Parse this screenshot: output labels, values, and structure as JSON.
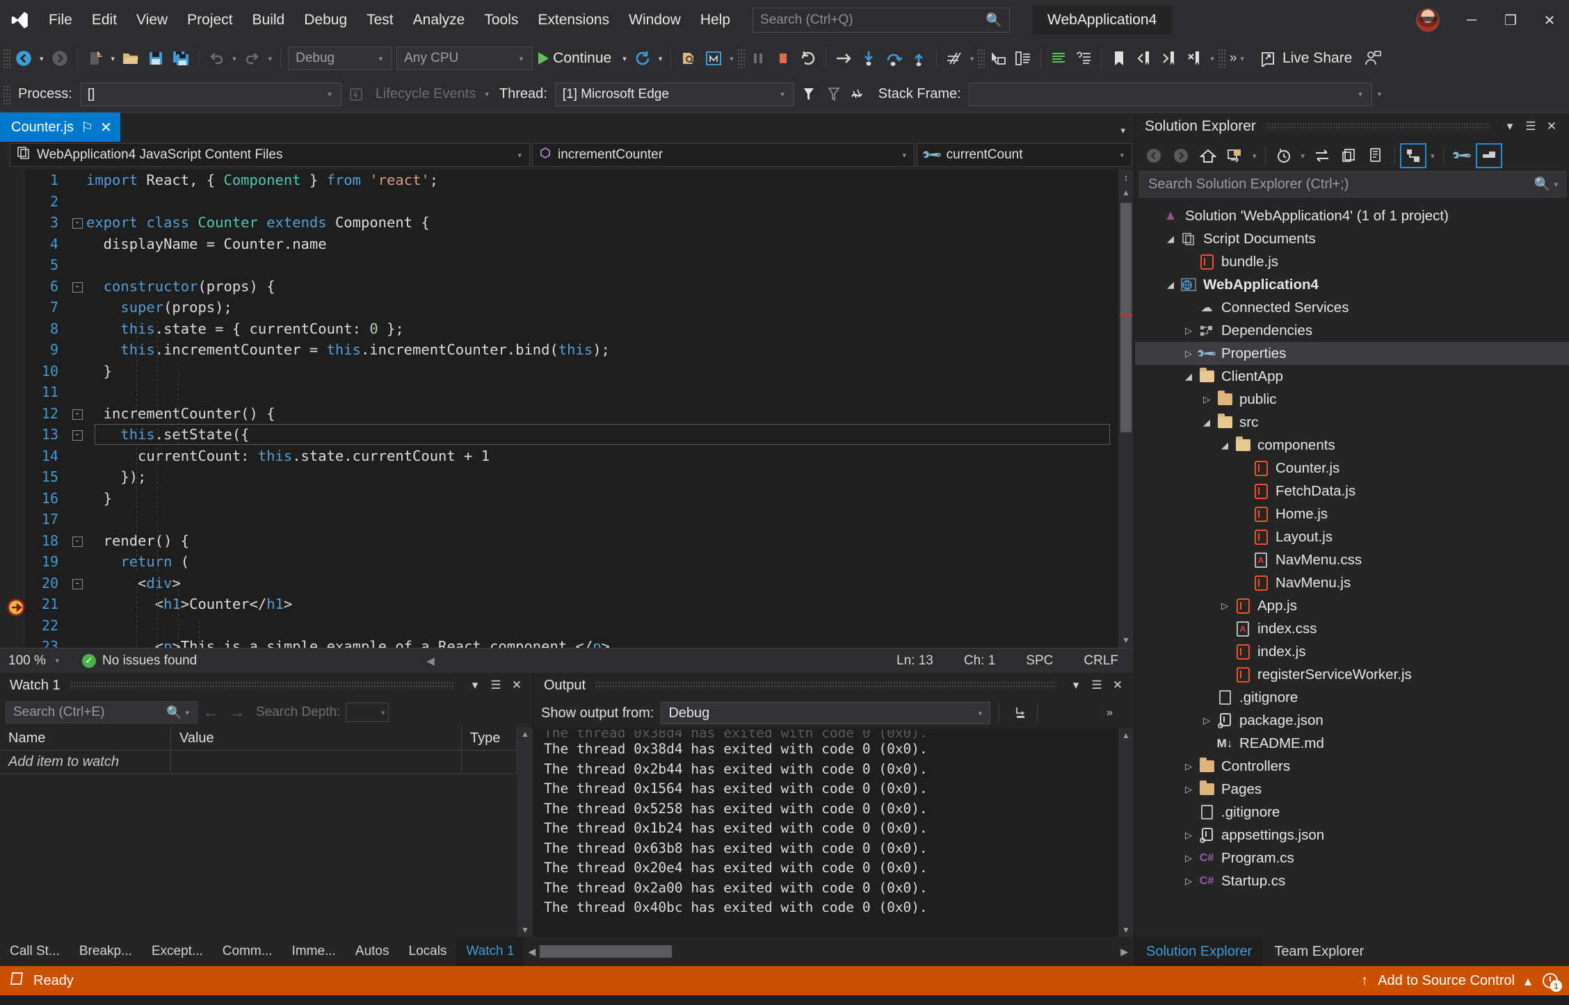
{
  "titlebar": {
    "logo": "visual-studio-logo",
    "menus": [
      "File",
      "Edit",
      "View",
      "Project",
      "Build",
      "Debug",
      "Test",
      "Analyze",
      "Tools",
      "Extensions",
      "Window",
      "Help"
    ],
    "search_placeholder": "Search (Ctrl+Q)",
    "window_title": "WebApplication4",
    "minimize": "─",
    "restore": "❐",
    "close": "✕"
  },
  "toolbar": {
    "back": "navigate-back",
    "forward": "navigate-forward",
    "new_item": "new-item",
    "open_file": "open-file",
    "save": "save",
    "save_all": "save-all",
    "undo": "undo",
    "redo": "redo",
    "config": "Debug",
    "platform": "Any CPU",
    "continue": "Continue",
    "restart": "restart",
    "attach": "attach-to-process",
    "browser": "select-browser",
    "pause": "break-all",
    "stop": "stop-debugging",
    "restart2": "restart-debugging",
    "step_over": "step-over",
    "step_into": "step-into",
    "step_out": "step-out",
    "step_up": "step-up",
    "hash": "show-next-statement",
    "live_share": "Live Share"
  },
  "debugbar": {
    "process_label": "Process:",
    "process_value": "[]",
    "lifecycle_label": "Lifecycle Events",
    "thread_label": "Thread:",
    "thread_value": "[1] Microsoft Edge",
    "stack_frame_label": "Stack Frame:",
    "stack_frame_value": ""
  },
  "editor": {
    "tab_name": "Counter.js",
    "pin": "⚐",
    "close": "✕",
    "nav_project": "WebApplication4 JavaScript Content Files",
    "nav_member": "incrementCounter",
    "nav_field": "currentCount",
    "current_line": 13,
    "code_lines": [
      {
        "n": 1,
        "fold": "",
        "tokens": [
          {
            "t": "import ",
            "c": "k-blue"
          },
          {
            "t": "React",
            "c": "k-white"
          },
          {
            "t": ", { ",
            "c": "k-white"
          },
          {
            "t": "Component",
            "c": "k-cyan"
          },
          {
            "t": " } ",
            "c": "k-white"
          },
          {
            "t": "from ",
            "c": "k-blue"
          },
          {
            "t": "'react'",
            "c": "k-str"
          },
          {
            "t": ";",
            "c": "k-white"
          }
        ],
        "indent": 0
      },
      {
        "n": 2,
        "fold": "",
        "tokens": [],
        "indent": 0
      },
      {
        "n": 3,
        "fold": "-",
        "tokens": [
          {
            "t": "export class ",
            "c": "k-blue"
          },
          {
            "t": "Counter",
            "c": "k-cyan"
          },
          {
            "t": " extends ",
            "c": "k-blue"
          },
          {
            "t": "Component",
            "c": "k-white"
          },
          {
            "t": " {",
            "c": "k-white"
          }
        ],
        "indent": 0
      },
      {
        "n": 4,
        "fold": "",
        "tokens": [
          {
            "t": "  displayName = Counter.name",
            "c": "k-white"
          }
        ],
        "indent": 1
      },
      {
        "n": 5,
        "fold": "",
        "tokens": [],
        "indent": 1
      },
      {
        "n": 6,
        "fold": "-",
        "tokens": [
          {
            "t": "  ",
            "c": "k-white"
          },
          {
            "t": "constructor",
            "c": "k-blue"
          },
          {
            "t": "(props) {",
            "c": "k-white"
          }
        ],
        "indent": 1
      },
      {
        "n": 7,
        "fold": "",
        "tokens": [
          {
            "t": "    ",
            "c": "k-white"
          },
          {
            "t": "super",
            "c": "k-blue"
          },
          {
            "t": "(props);",
            "c": "k-white"
          }
        ],
        "indent": 2
      },
      {
        "n": 8,
        "fold": "",
        "tokens": [
          {
            "t": "    ",
            "c": "k-white"
          },
          {
            "t": "this",
            "c": "k-blue"
          },
          {
            "t": ".state = { currentCount: ",
            "c": "k-white"
          },
          {
            "t": "0",
            "c": "k-num"
          },
          {
            "t": " };",
            "c": "k-white"
          }
        ],
        "indent": 2
      },
      {
        "n": 9,
        "fold": "",
        "tokens": [
          {
            "t": "    ",
            "c": "k-white"
          },
          {
            "t": "this",
            "c": "k-blue"
          },
          {
            "t": ".incrementCounter = ",
            "c": "k-white"
          },
          {
            "t": "this",
            "c": "k-blue"
          },
          {
            "t": ".incrementCounter.bind(",
            "c": "k-white"
          },
          {
            "t": "this",
            "c": "k-blue"
          },
          {
            "t": ");",
            "c": "k-white"
          }
        ],
        "indent": 2
      },
      {
        "n": 10,
        "fold": "",
        "tokens": [
          {
            "t": "  }",
            "c": "k-white"
          }
        ],
        "indent": 1
      },
      {
        "n": 11,
        "fold": "",
        "tokens": [],
        "indent": 1
      },
      {
        "n": 12,
        "fold": "-",
        "tokens": [
          {
            "t": "  incrementCounter() {",
            "c": "k-white"
          }
        ],
        "indent": 1
      },
      {
        "n": 13,
        "fold": "-",
        "tokens": [
          {
            "t": "    ",
            "c": "k-white"
          },
          {
            "t": "this",
            "c": "k-blue"
          },
          {
            "t": ".setState({",
            "c": "k-white"
          }
        ],
        "indent": 2
      },
      {
        "n": 14,
        "fold": "",
        "tokens": [
          {
            "t": "      currentCount: ",
            "c": "k-white"
          },
          {
            "t": "this",
            "c": "k-blue"
          },
          {
            "t": ".state.currentCount + ",
            "c": "k-white"
          },
          {
            "t": "1",
            "c": "k-white"
          }
        ],
        "indent": 3
      },
      {
        "n": 15,
        "fold": "",
        "tokens": [
          {
            "t": "    });",
            "c": "k-white"
          }
        ],
        "indent": 2
      },
      {
        "n": 16,
        "fold": "",
        "tokens": [
          {
            "t": "  }",
            "c": "k-white"
          }
        ],
        "indent": 1
      },
      {
        "n": 17,
        "fold": "",
        "tokens": [],
        "indent": 1
      },
      {
        "n": 18,
        "fold": "-",
        "tokens": [
          {
            "t": "  render() {",
            "c": "k-white"
          }
        ],
        "indent": 1
      },
      {
        "n": 19,
        "fold": "",
        "tokens": [
          {
            "t": "    ",
            "c": "k-white"
          },
          {
            "t": "return",
            "c": "k-blue"
          },
          {
            "t": " (",
            "c": "k-white"
          }
        ],
        "indent": 2
      },
      {
        "n": 20,
        "fold": "-",
        "tokens": [
          {
            "t": "      <",
            "c": "k-white"
          },
          {
            "t": "div",
            "c": "k-blue"
          },
          {
            "t": ">",
            "c": "k-white"
          }
        ],
        "indent": 3
      },
      {
        "n": 21,
        "fold": "",
        "tokens": [
          {
            "t": "        <",
            "c": "k-white"
          },
          {
            "t": "h1",
            "c": "k-blue"
          },
          {
            "t": ">Counter</",
            "c": "k-white"
          },
          {
            "t": "h1",
            "c": "k-blue"
          },
          {
            "t": ">",
            "c": "k-white"
          }
        ],
        "indent": 4
      },
      {
        "n": 22,
        "fold": "",
        "tokens": [],
        "indent": 4
      },
      {
        "n": 23,
        "fold": "",
        "tokens": [
          {
            "t": "        <",
            "c": "k-white"
          },
          {
            "t": "p",
            "c": "k-blue"
          },
          {
            "t": ">This is a simple example of a React component.</",
            "c": "k-white"
          },
          {
            "t": "p",
            "c": "k-blue"
          },
          {
            "t": ">",
            "c": "k-white"
          }
        ],
        "indent": 4
      }
    ],
    "status": {
      "zoom": "100 %",
      "issues": "No issues found",
      "line": "Ln: 13",
      "col": "Ch: 1",
      "spaces": "SPC",
      "eol": "CRLF"
    }
  },
  "watch_panel": {
    "title": "Watch 1",
    "search_placeholder": "Search (Ctrl+E)",
    "search_depth_label": "Search Depth:",
    "search_depth_value": "",
    "columns": [
      "Name",
      "Value",
      "Type"
    ],
    "rows": [
      {
        "name": "Add item to watch",
        "value": "",
        "type": ""
      }
    ]
  },
  "output_panel": {
    "title": "Output",
    "show_output_from_label": "Show output from:",
    "source": "Debug",
    "lines": [
      "The thread 0x38d4 has exited with code 0 (0x0).",
      "The thread 0x2b44 has exited with code 0 (0x0).",
      "The thread 0x1564 has exited with code 0 (0x0).",
      "The thread 0x5258 has exited with code 0 (0x0).",
      "The thread 0x1b24 has exited with code 0 (0x0).",
      "The thread 0x63b8 has exited with code 0 (0x0).",
      "The thread 0x20e4 has exited with code 0 (0x0).",
      "The thread 0x2a00 has exited with code 0 (0x0).",
      "The thread 0x40bc has exited with code 0 (0x0)."
    ]
  },
  "dock_tabs": {
    "items": [
      "Call St...",
      "Breakp...",
      "Except...",
      "Comm...",
      "Imme...",
      "Autos",
      "Locals",
      "Watch 1"
    ],
    "selected": "Watch 1"
  },
  "solution_explorer": {
    "title": "Solution Explorer",
    "search_placeholder": "Search Solution Explorer (Ctrl+;)",
    "toolbar_icons": [
      "back-icon",
      "forward-icon",
      "home-icon",
      "pending-changes-icon",
      "history-icon",
      "sync-icon",
      "collapse-all-icon",
      "properties-window-icon",
      "show-all-files-icon",
      "preview-selected-items-icon",
      "properties-icon",
      "hide-icon"
    ],
    "tree": [
      {
        "label": "Solution 'WebApplication4' (1 of 1 project)",
        "indent": 0,
        "expander": "",
        "icon": "solution-icon",
        "bold": false,
        "selected": false
      },
      {
        "label": "Script Documents",
        "indent": 1,
        "expander": "◢",
        "icon": "script-documents-icon",
        "bold": false,
        "selected": false
      },
      {
        "label": "bundle.js",
        "indent": 2,
        "expander": "",
        "icon": "js-icon",
        "bold": false,
        "selected": false
      },
      {
        "label": "WebApplication4",
        "indent": 1,
        "expander": "◢",
        "icon": "web-project-icon",
        "bold": true,
        "selected": false
      },
      {
        "label": "Connected Services",
        "indent": 2,
        "expander": "",
        "icon": "cloud-icon",
        "bold": false,
        "selected": false
      },
      {
        "label": "Dependencies",
        "indent": 2,
        "expander": "▷",
        "icon": "dependencies-icon",
        "bold": false,
        "selected": false
      },
      {
        "label": "Properties",
        "indent": 2,
        "expander": "▷",
        "icon": "wrench-icon",
        "bold": false,
        "selected": true
      },
      {
        "label": "ClientApp",
        "indent": 2,
        "expander": "◢",
        "icon": "folder-open-icon",
        "bold": false,
        "selected": false
      },
      {
        "label": "public",
        "indent": 3,
        "expander": "▷",
        "icon": "folder-icon",
        "bold": false,
        "selected": false
      },
      {
        "label": "src",
        "indent": 3,
        "expander": "◢",
        "icon": "folder-open-icon",
        "bold": false,
        "selected": false
      },
      {
        "label": "components",
        "indent": 4,
        "expander": "◢",
        "icon": "folder-open-icon",
        "bold": false,
        "selected": false
      },
      {
        "label": "Counter.js",
        "indent": 5,
        "expander": "",
        "icon": "js-icon",
        "bold": false,
        "selected": false
      },
      {
        "label": "FetchData.js",
        "indent": 5,
        "expander": "",
        "icon": "js-icon",
        "bold": false,
        "selected": false
      },
      {
        "label": "Home.js",
        "indent": 5,
        "expander": "",
        "icon": "js-icon",
        "bold": false,
        "selected": false
      },
      {
        "label": "Layout.js",
        "indent": 5,
        "expander": "",
        "icon": "js-icon",
        "bold": false,
        "selected": false
      },
      {
        "label": "NavMenu.css",
        "indent": 5,
        "expander": "",
        "icon": "css-icon",
        "bold": false,
        "selected": false
      },
      {
        "label": "NavMenu.js",
        "indent": 5,
        "expander": "",
        "icon": "js-icon",
        "bold": false,
        "selected": false
      },
      {
        "label": "App.js",
        "indent": 4,
        "expander": "▷",
        "icon": "js-icon",
        "bold": false,
        "selected": false
      },
      {
        "label": "index.css",
        "indent": 4,
        "expander": "",
        "icon": "css-icon",
        "bold": false,
        "selected": false
      },
      {
        "label": "index.js",
        "indent": 4,
        "expander": "",
        "icon": "js-icon",
        "bold": false,
        "selected": false
      },
      {
        "label": "registerServiceWorker.js",
        "indent": 4,
        "expander": "",
        "icon": "js-icon",
        "bold": false,
        "selected": false
      },
      {
        "label": ".gitignore",
        "indent": 3,
        "expander": "",
        "icon": "file-icon",
        "bold": false,
        "selected": false
      },
      {
        "label": "package.json",
        "indent": 3,
        "expander": "▷",
        "icon": "package-json-icon",
        "bold": false,
        "selected": false
      },
      {
        "label": "README.md",
        "indent": 3,
        "expander": "",
        "icon": "markdown-icon",
        "bold": false,
        "selected": false
      },
      {
        "label": "Controllers",
        "indent": 2,
        "expander": "▷",
        "icon": "folder-icon",
        "bold": false,
        "selected": false
      },
      {
        "label": "Pages",
        "indent": 2,
        "expander": "▷",
        "icon": "folder-icon",
        "bold": false,
        "selected": false
      },
      {
        "label": ".gitignore",
        "indent": 2,
        "expander": "",
        "icon": "file-icon",
        "bold": false,
        "selected": false
      },
      {
        "label": "appsettings.json",
        "indent": 2,
        "expander": "▷",
        "icon": "package-json-icon",
        "bold": false,
        "selected": false
      },
      {
        "label": "Program.cs",
        "indent": 2,
        "expander": "▷",
        "icon": "csharp-icon",
        "bold": false,
        "selected": false
      },
      {
        "label": "Startup.cs",
        "indent": 2,
        "expander": "▷",
        "icon": "csharp-icon",
        "bold": false,
        "selected": false
      }
    ],
    "tabs": [
      "Solution Explorer",
      "Team Explorer"
    ],
    "selected_tab": "Solution Explorer"
  },
  "statusbar": {
    "ready": "Ready",
    "source_control": "Add to Source Control",
    "notification_count": "1",
    "accent": "#ca5100"
  }
}
